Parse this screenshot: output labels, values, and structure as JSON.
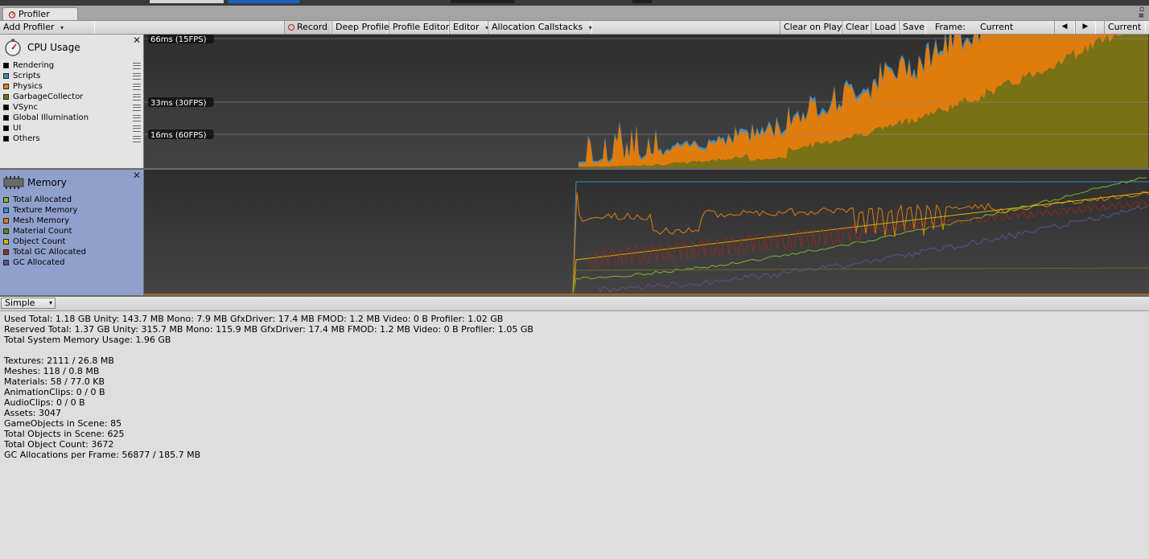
{
  "window": {
    "tab_label": "Profiler",
    "controls": [
      "▫",
      "≡"
    ]
  },
  "toolbar": {
    "add_profiler": "Add Profiler",
    "record": "Record",
    "deep_profile": "Deep Profile",
    "profile_editor": "Profile Editor",
    "editor": "Editor",
    "allocation_callstacks": "Allocation Callstacks",
    "clear_on_play": "Clear on Play",
    "clear": "Clear",
    "load": "Load",
    "save": "Save",
    "frame_label": "Frame:",
    "frame_value": "Current",
    "prev_icon": "◀",
    "next_icon": "▶",
    "current": "Current"
  },
  "cpu": {
    "title": "CPU Usage",
    "close": "✕",
    "legend": [
      {
        "label": "Rendering",
        "color": "#000000"
      },
      {
        "label": "Scripts",
        "color": "#3a8fc4"
      },
      {
        "label": "Physics",
        "color": "#e07c0c"
      },
      {
        "label": "GarbageCollector",
        "color": "#7a7016"
      },
      {
        "label": "VSync",
        "color": "#000000"
      },
      {
        "label": "Global Illumination",
        "color": "#000000"
      },
      {
        "label": "UI",
        "color": "#000000"
      },
      {
        "label": "Others",
        "color": "#000000"
      }
    ],
    "ref_lines": [
      "66ms (15FPS)",
      "33ms (30FPS)",
      "16ms (60FPS)"
    ]
  },
  "memory": {
    "title": "Memory",
    "close": "✕",
    "legend": [
      {
        "label": "Total Allocated",
        "color": "#7ab82a"
      },
      {
        "label": "Texture Memory",
        "color": "#3a8fc4"
      },
      {
        "label": "Mesh Memory",
        "color": "#e07c0c"
      },
      {
        "label": "Material Count",
        "color": "#6e7a1c"
      },
      {
        "label": "Object Count",
        "color": "#d8b400"
      },
      {
        "label": "Total GC Allocated",
        "color": "#a02a1a"
      },
      {
        "label": "GC Allocated",
        "color": "#5a5290"
      }
    ]
  },
  "details": {
    "mode": "Simple",
    "lines": [
      "Used Total: 1.18 GB   Unity: 143.7 MB   Mono: 7.9 MB   GfxDriver: 17.4 MB   FMOD: 1.2 MB   Video: 0 B   Profiler: 1.02 GB",
      "Reserved Total: 1.37 GB   Unity: 315.7 MB   Mono: 115.9 MB   GfxDriver: 17.4 MB   FMOD: 1.2 MB   Video: 0 B   Profiler: 1.05 GB",
      "Total System Memory Usage: 1.96 GB",
      "",
      "Textures: 2111 / 26.8 MB",
      "Meshes: 118 / 0.8 MB",
      "Materials: 58 / 77.0 KB",
      "AnimationClips: 0 / 0 B",
      "AudioClips: 0 / 0 B",
      "Assets: 3047",
      "GameObjects in Scene: 85",
      "Total Objects in Scene: 625",
      "Total Object Count: 3672",
      "GC Allocations per Frame: 56877 / 185.7 MB"
    ]
  },
  "colors": {
    "chart_bg": "#3c3c3c",
    "garbage": "#7a7016",
    "physics": "#e07c0c",
    "scripts": "#3a8fc4"
  }
}
